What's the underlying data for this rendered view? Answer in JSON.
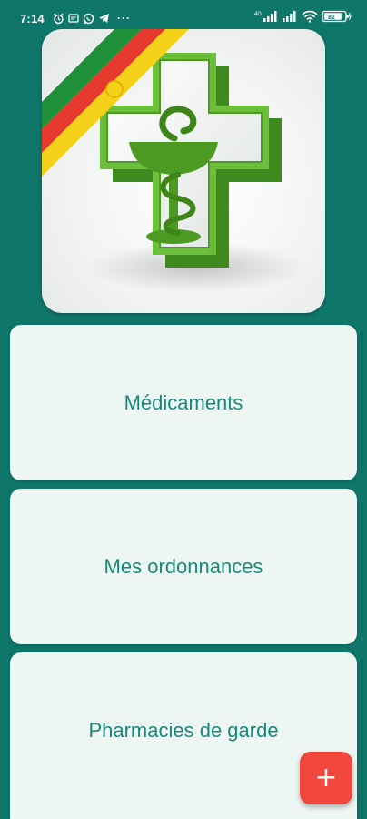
{
  "status_bar": {
    "time": "7:14",
    "network_label": "4G",
    "battery_level": "82",
    "more_indicator": "···",
    "left_icons": [
      "alarm-icon",
      "notification-icon",
      "whatsapp-icon",
      "telegram-icon"
    ],
    "right_icons": [
      "signal-icon",
      "signal-icon",
      "wifi-icon",
      "battery-icon"
    ]
  },
  "hero": {
    "icon": "pharmacy-cross-logo",
    "colors": {
      "cross": "#58a52e",
      "stripe_green": "#1f8f3a",
      "stripe_red": "#e53b2f",
      "stripe_yellow": "#f5d21a"
    }
  },
  "menu": [
    {
      "label": "Médicaments"
    },
    {
      "label": "Mes ordonnances"
    },
    {
      "label": "Pharmacies de garde"
    }
  ],
  "fab": {
    "label": "+",
    "icon": "plus-icon"
  },
  "colors": {
    "background": "#0f766a",
    "card": "#eef6f4",
    "card_text": "#16897a",
    "fab": "#f2473d"
  }
}
